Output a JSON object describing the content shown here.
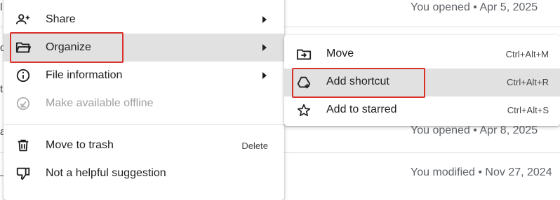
{
  "background": {
    "rows": [
      {
        "meta": "You opened • Apr 5, 2025"
      },
      {
        "meta": ""
      },
      {
        "meta": "You opened • Apr 8, 2025"
      },
      {
        "meta": "You modified • Nov 27, 2024"
      }
    ],
    "edge_chars": [
      "l",
      "c",
      "t",
      "a",
      "_"
    ]
  },
  "menu": {
    "items": [
      {
        "label": "Share",
        "icon": "person-add-icon",
        "has_submenu": true
      },
      {
        "label": "Organize",
        "icon": "folder-open-icon",
        "has_submenu": true,
        "active": true
      },
      {
        "label": "File information",
        "icon": "info-icon",
        "has_submenu": true
      },
      {
        "label": "Make available offline",
        "icon": "offline-check-icon",
        "disabled": true
      },
      {
        "label": "Move to trash",
        "icon": "trash-icon",
        "shortcut": "Delete"
      },
      {
        "label": "Not a helpful suggestion",
        "icon": "thumb-down-icon"
      }
    ]
  },
  "submenu": {
    "items": [
      {
        "label": "Move",
        "icon": "move-to-folder-icon",
        "shortcut": "Ctrl+Alt+M"
      },
      {
        "label": "Add shortcut",
        "icon": "add-shortcut-icon",
        "shortcut": "Ctrl+Alt+R",
        "active": true
      },
      {
        "label": "Add to starred",
        "icon": "star-icon",
        "shortcut": "Ctrl+Alt+S"
      }
    ]
  },
  "colors": {
    "highlight": "#d9302a",
    "active_bg": "#e1e1e1",
    "text": "#1f1f1f",
    "disabled_text": "#a0a0a0"
  }
}
